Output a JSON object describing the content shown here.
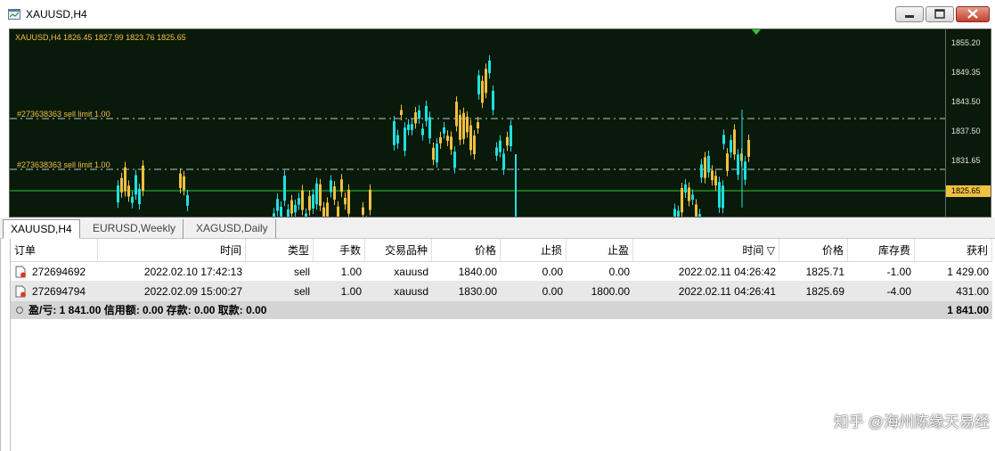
{
  "window": {
    "title": "XAUUSD,H4"
  },
  "chart": {
    "header": "XAUUSD,H4  1826.45 1827.99 1823.76 1825.65",
    "price_ticks": [
      "1855.20",
      "1849.35",
      "1843.50",
      "1837.50",
      "1831.65",
      "1825.65"
    ],
    "last_price": "1825.65",
    "order_lines": [
      {
        "label": "#273638363 sell limit 1.00"
      },
      {
        "label": "#273638363 sell limit 1.00"
      }
    ],
    "colors": {
      "background": "#0a1a0a",
      "bull": "#f0c040",
      "bear": "#20e0e0",
      "line": "#2ec82e"
    }
  },
  "tabs": [
    "XAUUSD,H4",
    "EURUSD,Weekly",
    "XAGUSD,Daily"
  ],
  "table": {
    "columns": [
      "订单",
      "时间",
      "类型",
      "手数",
      "交易品种",
      "价格",
      "止损",
      "止盈",
      "时间 ▽",
      "价格",
      "库存费",
      "获利"
    ],
    "rows": [
      [
        "272694692",
        "2022.02.10 17:42:13",
        "sell",
        "1.00",
        "xauusd",
        "1840.00",
        "0.00",
        "0.00",
        "2022.02.11 04:26:42",
        "1825.71",
        "-1.00",
        "1 429.00"
      ],
      [
        "272694794",
        "2022.02.09 15:00:27",
        "sell",
        "1.00",
        "xauusd",
        "1830.00",
        "0.00",
        "1800.00",
        "2022.02.11 04:26:41",
        "1825.69",
        "-4.00",
        "431.00"
      ]
    ],
    "summary": {
      "text": "盈/亏: 1 841.00  信用额: 0.00  存款: 0.00  取款: 0.00",
      "total": "1 841.00"
    }
  },
  "watermark": "知乎 @海州陈缘天易经"
}
